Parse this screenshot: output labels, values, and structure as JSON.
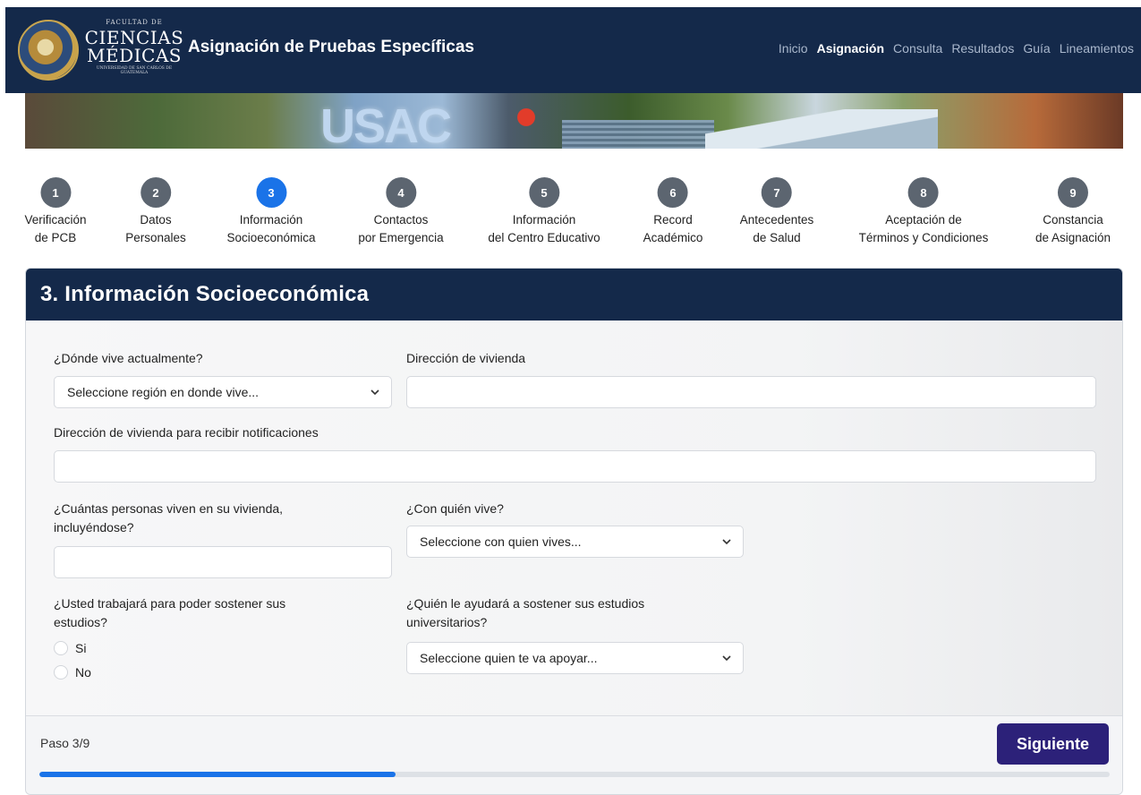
{
  "header": {
    "logo_small": "FACULTAD DE",
    "logo_line1": "CIENCIAS",
    "logo_line2": "MÉDICAS",
    "logo_tiny": "UNIVERSIDAD DE SAN CARLOS DE GUATEMALA",
    "title": "Asignación de Pruebas Específicas",
    "nav": [
      {
        "label": "Inicio",
        "active": false
      },
      {
        "label": "Asignación",
        "active": true
      },
      {
        "label": "Consulta",
        "active": false
      },
      {
        "label": "Resultados",
        "active": false
      },
      {
        "label": "Guía",
        "active": false
      },
      {
        "label": "Lineamientos",
        "active": false
      }
    ]
  },
  "banner": {
    "text": "USAC"
  },
  "steps": [
    {
      "num": "1",
      "line1": "Verificación",
      "line2": "de PCB"
    },
    {
      "num": "2",
      "line1": "Datos",
      "line2": "Personales"
    },
    {
      "num": "3",
      "line1": "Información",
      "line2": "Socioeconómica"
    },
    {
      "num": "4",
      "line1": "Contactos",
      "line2": "por Emergencia"
    },
    {
      "num": "5",
      "line1": "Información",
      "line2": "del Centro Educativo"
    },
    {
      "num": "6",
      "line1": "Record",
      "line2": "Académico"
    },
    {
      "num": "7",
      "line1": "Antecedentes",
      "line2": "de Salud"
    },
    {
      "num": "8",
      "line1": "Aceptación de",
      "line2": "Términos y Condiciones"
    },
    {
      "num": "9",
      "line1": "Constancia",
      "line2": "de Asignación"
    }
  ],
  "current_step": 3,
  "form": {
    "title": "3. Información Socioeconómica",
    "donde_vive_label": "¿Dónde vive actualmente?",
    "donde_vive_value": "Seleccione región en donde vive...",
    "direccion_label": "Dirección de vivienda",
    "direccion_value": "",
    "notif_label": "Dirección de vivienda para recibir notificaciones",
    "notif_value": "",
    "personas_label_1": "¿Cuántas personas viven en su vivienda,",
    "personas_label_2": "incluyéndose?",
    "personas_value": "",
    "con_quien_label": "¿Con quién vive?",
    "con_quien_value": "Seleccione con quien vives...",
    "trabajara_label_1": "¿Usted trabajará para poder sostener sus",
    "trabajara_label_2": "estudios?",
    "radio_si": "Si",
    "radio_no": "No",
    "ayuda_label_1": "¿Quién le ayudará a sostener sus estudios",
    "ayuda_label_2": "universitarios?",
    "ayuda_value": "Seleccione quien te va apoyar..."
  },
  "footer": {
    "paso": "Paso 3/9",
    "next_label": "Siguiente",
    "progress_fraction": 0.333
  },
  "colors": {
    "navy": "#14294a",
    "accent_blue": "#1a73e8",
    "button_purple": "#2c2179",
    "inactive_step": "#5c6570"
  }
}
